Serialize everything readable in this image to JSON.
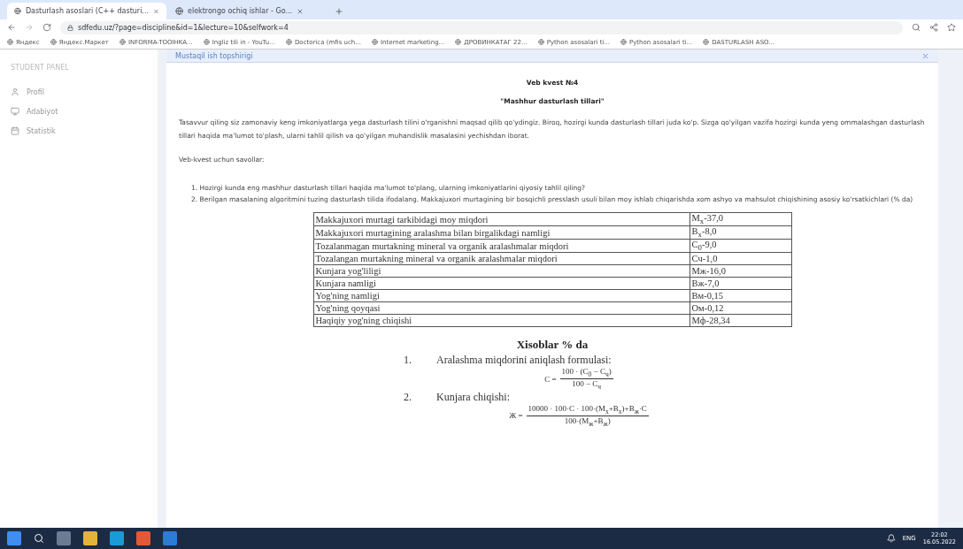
{
  "browser": {
    "tabs": [
      {
        "label": "Dasturlash asoslari (C++ dasturi...",
        "selected": true
      },
      {
        "label": "elektrongo ochiq ishlar - Go...",
        "selected": false
      }
    ],
    "address": "sdfedu.uz/?page=discipline&id=1&lecture=10&selfwork=4",
    "bookmarks": [
      {
        "label": "Яндекс"
      },
      {
        "label": "Яндекс.Маркет"
      },
      {
        "label": "INFORMA-TOOIHKA..."
      },
      {
        "label": "Ingliz tili in - YouTu..."
      },
      {
        "label": "Doctorica (mfis uch..."
      },
      {
        "label": "Internet marketing..."
      },
      {
        "label": "ДРОВИНКАТАГ 22..."
      },
      {
        "label": "Python asosalari ti..."
      },
      {
        "label": "Python asosalari ti..."
      },
      {
        "label": "DASTURLASH ASO..."
      }
    ]
  },
  "sidebar": {
    "heading": "STUDENT PANEL",
    "items": [
      {
        "label": "Profil"
      },
      {
        "label": "Adabiyot"
      },
      {
        "label": "Statistik"
      }
    ]
  },
  "panel": {
    "header": "Mustaqil ish topshirigi",
    "title": "Veb kvest №4",
    "subtitle": "\"Mashhur dasturlash tillari\"",
    "paragraph": "Tasavvur qiling siz zamonaviy keng imkoniyatlarga yega dasturlash tilini o'rganishni maqsad qilib qo'ydingiz. Biroq, hozirgi kunda dasturlash tillari juda ko'p. Sizga qo'yilgan vazifa hozirgi kunda yeng ommalashgan dasturlash tillari haqida ma'lumot to'plash, ularni tahlil qilish va qo'yilgan muhandislik masalasini yechishdan iborat.",
    "questions_heading": "Veb-kvest uchun savollar:",
    "questions": [
      "1. Hozirgi kunda eng mashhur dasturlash tillari haqida ma'lumot to'plang, ularning imkoniyatlarini qiyosiy tahlil qiling?",
      "2. Berilgan masalaning algoritmini tuzing dasturlash tilida ifodalang. Makkajuxori murtagining bir bosqichli presslash usuli bilan moy ishlab chiqarishda xom ashyo va mahsulot chiqishining asosiy ko'rsatkichlari (% da)"
    ],
    "table": [
      {
        "name": "Makkajuxori murtagi  tarkibidagi moy miqdori",
        "value": "M$_{x}$-37,0"
      },
      {
        "name": "Makkajuxori murtagining aralashma bilan birgalikdagi namligi",
        "value": "B$_{x}$-8,0"
      },
      {
        "name": "Tozalanmagan murtakning mineral va organik aralashmalar miqdori",
        "value": "C$_{0}$-9,0"
      },
      {
        "name": "Tozalangan murtakning mineral va organik aralashmalar miqdori",
        "value": "Cч-1,0"
      },
      {
        "name": "Kunjara yog'liligi",
        "value": "Mж-16,0"
      },
      {
        "name": "Kunjara namligi",
        "value": "Bж-7,0"
      },
      {
        "name": "Yog'ning namligi",
        "value": "Bм-0,15"
      },
      {
        "name": " Yog'ning qoyqasi",
        "value": "Oм-0,12"
      },
      {
        "name": "Haqiqiy yog'ning chiqishi",
        "value": "Mф-28,34"
      }
    ],
    "calc_title": "Xisoblar % da",
    "steps": [
      {
        "number": "1.",
        "text": "Aralashma miqdorini aniqlash formulasi:",
        "lhs": "C =",
        "numerator": "100 · (C$_{0}$ − C$_{ч}$)",
        "denominator": "100 − C$_{ч}$"
      },
      {
        "number": "2.",
        "text": "Kunjara chiqishi:",
        "lhs": "Ж =",
        "numerator": "10000 · 100·C · 100·(M$_{x}$+B$_{x}$)+B$_{ж}$·C",
        "denominator": "100·(M$_{ж}$+B$_{ж}$)"
      }
    ]
  },
  "taskbar": {
    "language": "ENG",
    "time": "22:02",
    "date": "16.05.2022"
  }
}
